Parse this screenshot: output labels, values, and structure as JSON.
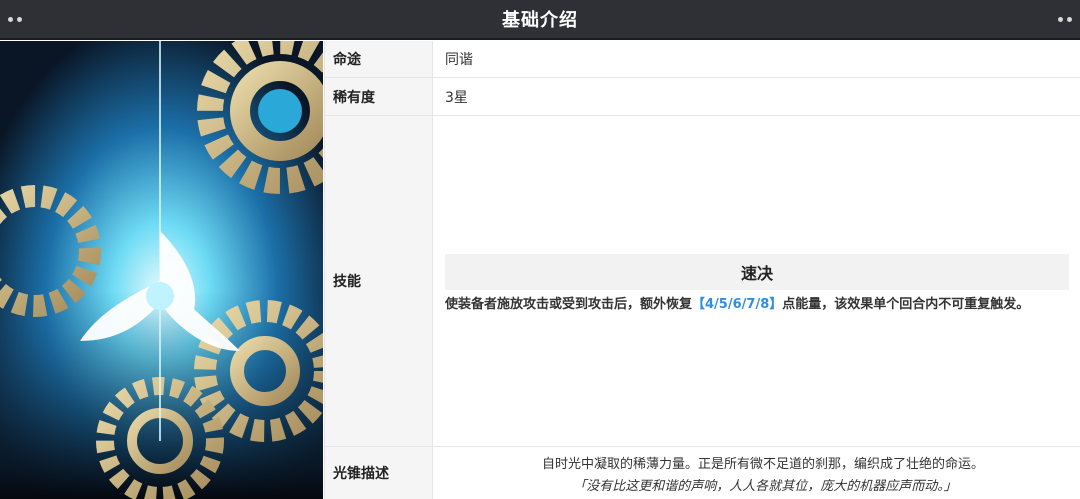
{
  "header": {
    "title": "基础介绍"
  },
  "table": {
    "rows": [
      {
        "label": "命途",
        "value": "同谐"
      },
      {
        "label": "稀有度",
        "value": "3星"
      }
    ],
    "skill": {
      "label": "技能",
      "name": "速决",
      "text_before": "使装备者施放攻击或受到攻击后，额外恢复",
      "highlight": "【4/5/6/7/8】",
      "text_after": "点能量，该效果单个回合内不可重复触发。"
    },
    "description": {
      "label": "光锥描述",
      "line1": "自时光中凝取的稀薄力量。正是所有微不足道的刹那，编织成了壮绝的命运。",
      "line2": "「没有比这更和谐的声响，人人各就其位，庞大的机器应声而动。」"
    }
  },
  "colors": {
    "header_bg": "#2e3035",
    "highlight": "#2f8ee0",
    "label_bg": "#f5f5f5"
  }
}
